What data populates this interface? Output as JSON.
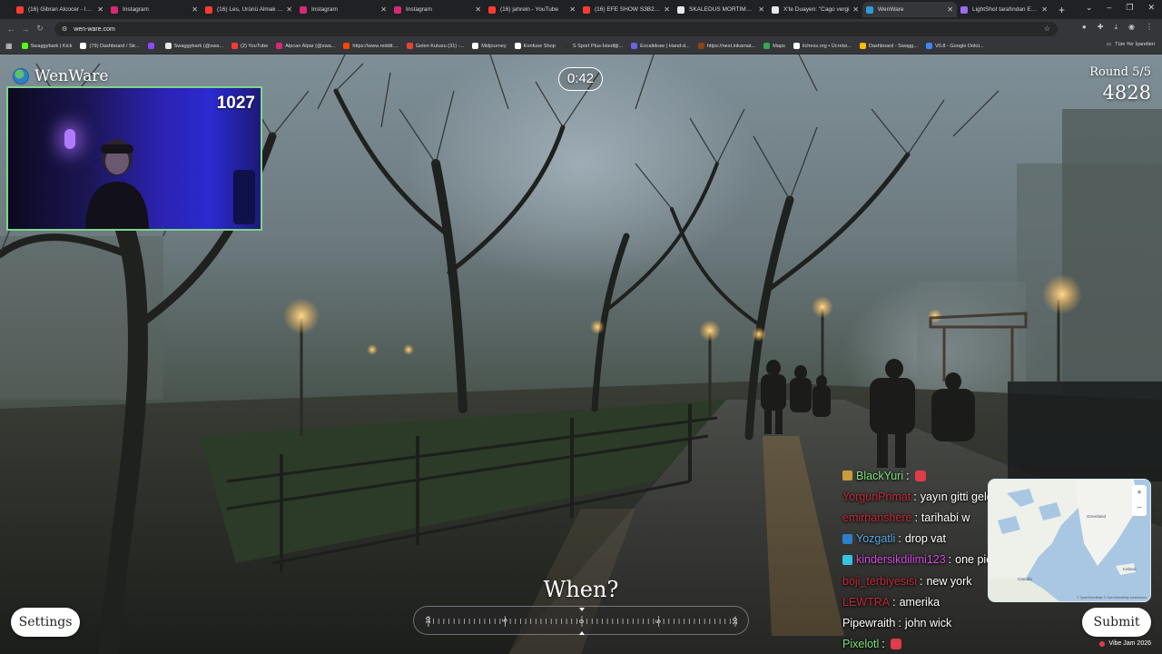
{
  "browser": {
    "tabs": [
      {
        "title": "(16) Gibran Alcocer - Idea",
        "fav": "#ff3b30"
      },
      {
        "title": "Instagram",
        "fav": "#d62976"
      },
      {
        "title": "(16) Les, Ürünü Almak İçin",
        "fav": "#ff3b30"
      },
      {
        "title": "Instagram",
        "fav": "#d62976"
      },
      {
        "title": "Instagram",
        "fav": "#d62976"
      },
      {
        "title": "(16) jahrein - YouTube",
        "fav": "#ff3b30"
      },
      {
        "title": "(16) EFE SHOW S3B26 | M",
        "fav": "#ff3b30"
      },
      {
        "title": "SKALEDUS MORTIMAS To",
        "fav": "#e8e8e8"
      },
      {
        "title": "X'te Duayen: \"Cago vergi",
        "fav": "#e8e8e8"
      },
      {
        "title": "WenWare",
        "fav": "#2e9ad8",
        "active": true
      },
      {
        "title": "LightShot tarafından Ekra",
        "fav": "#9b6cf2"
      }
    ],
    "url": "wen-ware.com",
    "bookmarks": [
      {
        "label": "Swaggybark | Kick",
        "fav": "#53fc18"
      },
      {
        "label": "(79) Dashboard / Str...",
        "fav": "#ffffff"
      },
      {
        "label": "",
        "fav": "#9147ff"
      },
      {
        "label": "Swaggybark (@swa...",
        "fav": "#e8e8e8"
      },
      {
        "label": "(2) YouTube",
        "fav": "#ff3b30"
      },
      {
        "label": "Alpcan Alpar (@swa...",
        "fav": "#d62976"
      },
      {
        "label": "https://www.reddit....",
        "fav": "#ff4500"
      },
      {
        "label": "Gelen Kutusu (31) -...",
        "fav": "#ea4335"
      },
      {
        "label": "Midjourney",
        "fav": "#ffffff"
      },
      {
        "label": "Konfuse Shop",
        "fav": "#ffffff"
      },
      {
        "label": "S Sport Plus-İstediği...",
        "fav": "#333333"
      },
      {
        "label": "Excalidraw | Hand-d...",
        "fav": "#6965db"
      },
      {
        "label": "https://next.inkarnat...",
        "fav": "#8b4513"
      },
      {
        "label": "Maps",
        "fav": "#34a853"
      },
      {
        "label": "lichess.org • Ücretsi...",
        "fav": "#ffffff"
      },
      {
        "label": "Dashboard - Swagg...",
        "fav": "#fbbc04"
      },
      {
        "label": "V0.8 - Google Dokü...",
        "fav": "#4285f4"
      }
    ],
    "all_bookmarks": "Tüm Yer İşaretleri"
  },
  "game": {
    "brand": "WenWare",
    "webcam_score": "1027",
    "timer": "0:42",
    "round": "Round 5/5",
    "total_score": "4828",
    "prompt": "When?",
    "settings_label": "Settings",
    "submit_label": "Submit",
    "credit": "Vibe Jam 2026",
    "slider_labels": [
      "-10",
      "-5",
      "0",
      "5",
      "10"
    ]
  },
  "chat": [
    {
      "user": "BlackYuri",
      "color": "#7fe07a",
      "msg": "",
      "emote": true,
      "badge": "#c89b3c"
    },
    {
      "user": "YorgunPrimat",
      "color": "#c0283a",
      "msg": "yayın gitti geldi"
    },
    {
      "user": "emirhanshere",
      "color": "#c0283a",
      "msg": "tarihabi w"
    },
    {
      "user": "Yozgatli",
      "color": "#5aa9e6",
      "msg": "drop vat",
      "badge": "#2e7ec9"
    },
    {
      "user": "kindersikdilimi123",
      "color": "#d24ae0",
      "msg": "one piece göndermesi",
      "badge": "#35c3e0"
    },
    {
      "user": "boji_terbiyesisi",
      "color": "#c0283a",
      "msg": "new york"
    },
    {
      "user": "LEWTRA",
      "color": "#c0283a",
      "msg": "amerika"
    },
    {
      "user": "Pipewraith",
      "color": "#ffffff",
      "msg": "john wick"
    },
    {
      "user": "Pixelotl",
      "color": "#7fe07a",
      "msg": "",
      "emote": true
    }
  ],
  "map": {
    "labels": [
      "Greenland",
      "Canada",
      "Iceland"
    ],
    "attribution": "© OpenStreetMap © OpenStreetMap contributors"
  }
}
